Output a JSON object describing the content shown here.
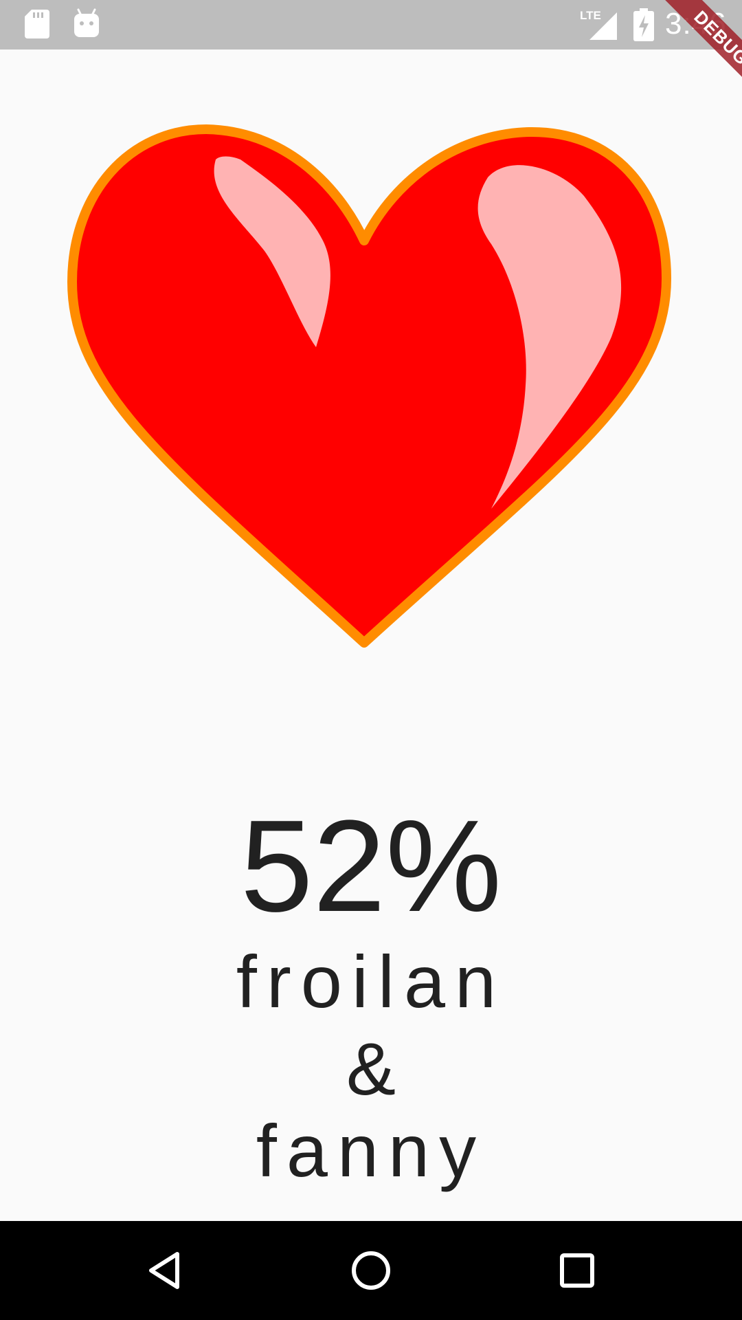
{
  "status_bar": {
    "left_icons": [
      "sd-card-icon",
      "android-icon"
    ],
    "network": "LTE",
    "battery_icon": "battery-charging-icon",
    "time": "3:46",
    "background": "#bdbdbd"
  },
  "debug_banner": {
    "label": "DEBUG",
    "color": "#a02028"
  },
  "heart": {
    "icon": "heart-icon",
    "fill": "#ff0000",
    "outline": "#ff8c00",
    "highlight": "#ffb3b3"
  },
  "result": {
    "percent": "52%",
    "name1": "froilan",
    "ampersand": "&",
    "name2": "fanny"
  },
  "nav_bar": {
    "buttons": [
      "back-icon",
      "home-icon",
      "recents-icon"
    ],
    "background": "#000000"
  }
}
